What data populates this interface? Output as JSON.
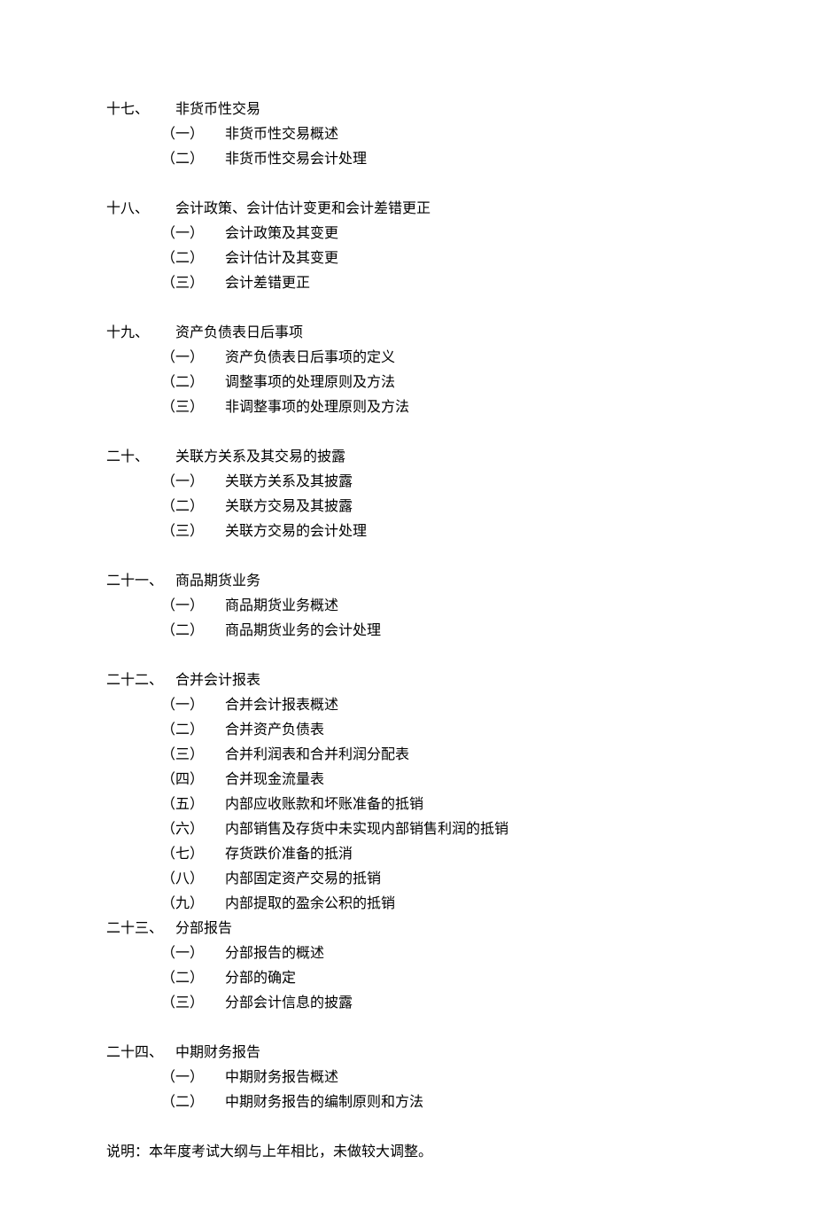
{
  "sections": [
    {
      "num": "十七、",
      "title": "非货币性交易",
      "items": [
        {
          "marker": "（一）",
          "text": "非货币性交易概述"
        },
        {
          "marker": "（二）",
          "text": "非货币性交易会计处理"
        }
      ],
      "tight": false
    },
    {
      "num": "十八、",
      "title": "会计政策、会计估计变更和会计差错更正",
      "items": [
        {
          "marker": "（一）",
          "text": "会计政策及其变更"
        },
        {
          "marker": "（二）",
          "text": "会计估计及其变更"
        },
        {
          "marker": "（三）",
          "text": "会计差错更正"
        }
      ],
      "tight": false
    },
    {
      "num": "十九、",
      "title": "资产负债表日后事项",
      "items": [
        {
          "marker": "（一）",
          "text": "资产负债表日后事项的定义"
        },
        {
          "marker": "（二）",
          "text": "调整事项的处理原则及方法"
        },
        {
          "marker": "（三）",
          "text": "非调整事项的处理原则及方法"
        }
      ],
      "tight": false
    },
    {
      "num": "二十、",
      "title": "关联方关系及其交易的披露",
      "items": [
        {
          "marker": "（一）",
          "text": "关联方关系及其披露"
        },
        {
          "marker": "（二）",
          "text": "关联方交易及其披露"
        },
        {
          "marker": "（三）",
          "text": "关联方交易的会计处理"
        }
      ],
      "tight": false
    },
    {
      "num": "二十一、",
      "title": "商品期货业务",
      "items": [
        {
          "marker": "（一）",
          "text": "商品期货业务概述"
        },
        {
          "marker": "（二）",
          "text": "商品期货业务的会计处理"
        }
      ],
      "tight": false
    },
    {
      "num": "二十二、",
      "title": "合并会计报表",
      "items": [
        {
          "marker": "（一）",
          "text": "合并会计报表概述"
        },
        {
          "marker": "（二）",
          "text": "合并资产负债表"
        },
        {
          "marker": "（三）",
          "text": "合并利润表和合并利润分配表"
        },
        {
          "marker": "（四）",
          "text": "合并现金流量表"
        },
        {
          "marker": "（五）",
          "text": "内部应收账款和坏账准备的抵销"
        },
        {
          "marker": "（六）",
          "text": "内部销售及存货中未实现内部销售利润的抵销"
        },
        {
          "marker": "（七）",
          "text": "存货跌价准备的抵消"
        },
        {
          "marker": "（八）",
          "text": "内部固定资产交易的抵销"
        },
        {
          "marker": "（九）",
          "text": "内部提取的盈余公积的抵销"
        }
      ],
      "tight": true
    },
    {
      "num": "二十三、",
      "title": "分部报告",
      "items": [
        {
          "marker": "（一）",
          "text": "分部报告的概述"
        },
        {
          "marker": "（二）",
          "text": "分部的确定"
        },
        {
          "marker": "（三）",
          "text": "分部会计信息的披露"
        }
      ],
      "tight": false
    },
    {
      "num": "二十四、",
      "title": "中期财务报告",
      "items": [
        {
          "marker": "（一）",
          "text": "中期财务报告概述"
        },
        {
          "marker": "（二）",
          "text": "中期财务报告的编制原则和方法"
        }
      ],
      "tight": false
    }
  ],
  "note": "说明：本年度考试大纲与上年相比，未做较大调整。"
}
